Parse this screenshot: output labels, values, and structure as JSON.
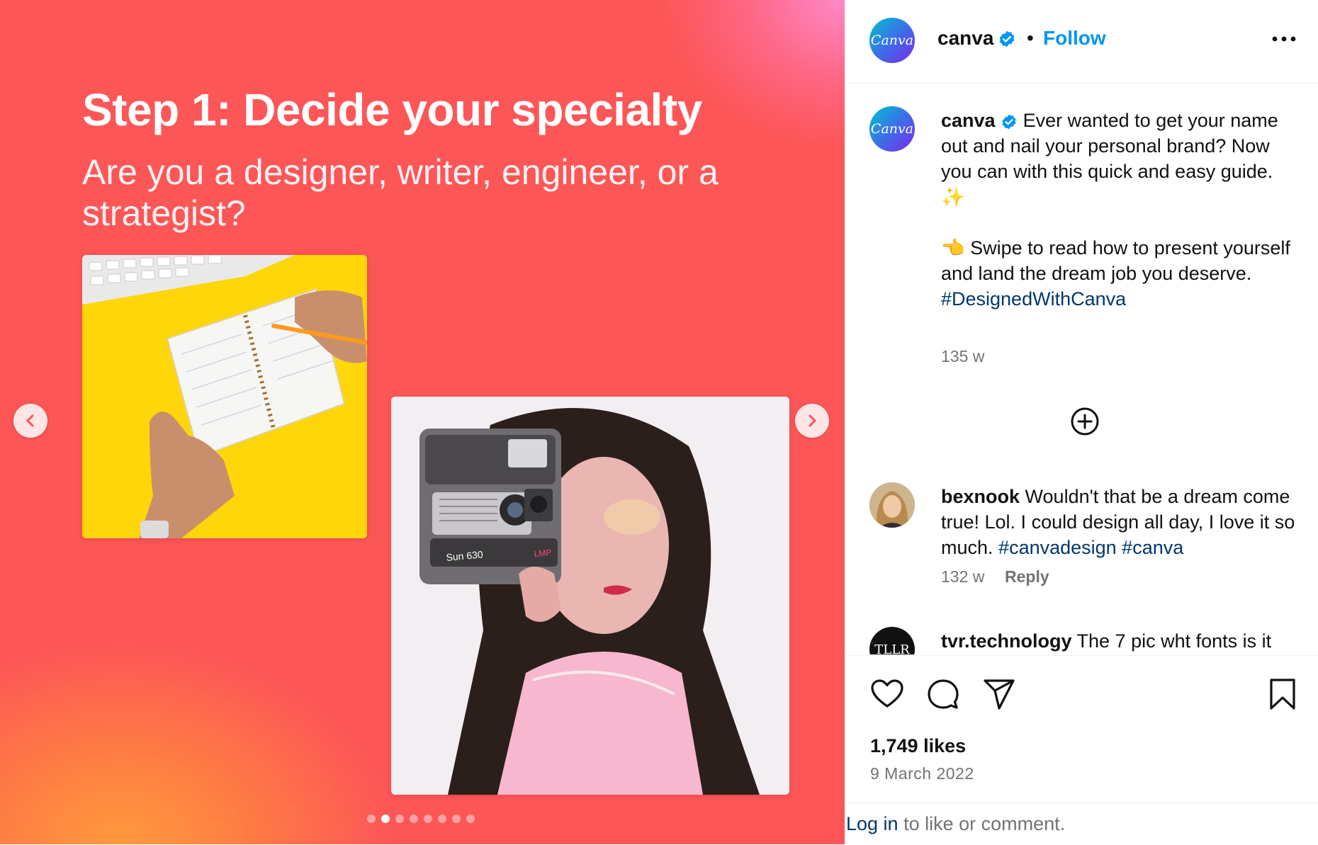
{
  "slide": {
    "title": "Step 1: Decide your specialty",
    "subtitle": "Are you a designer, writer, engineer, or a strategist?",
    "camera_model_text": "Sun 630",
    "camera_brand_text": "LMP",
    "current_index": 2,
    "total": 8,
    "background_color": "#fd5657"
  },
  "header": {
    "avatar_text": "Canva",
    "username": "canva",
    "separator": "•",
    "follow_label": "Follow"
  },
  "caption": {
    "avatar_text": "Canva",
    "username": "canva",
    "line1": "Ever wanted to get your name out and nail your personal brand? Now you can with this quick and easy guide.",
    "emoji1": "✨",
    "emoji2": "👈",
    "line2": "Swipe to read how to present yourself and land the dream job you deserve.",
    "hashtag": "#DesignedWithCanva",
    "time": "135 w"
  },
  "comments": [
    {
      "username": "bexnook",
      "text": "Wouldn't that be a dream come true! Lol. I could design all day, I love it so much.",
      "hashtags": "#canvadesign #canva",
      "time": "132 w",
      "reply_label": "Reply"
    },
    {
      "username": "tvr.technology",
      "avatar_text": "TLLR",
      "text": "The 7 pic wht fonts is it"
    }
  ],
  "actions": {
    "likes": "1,749 likes",
    "date": "9 March 2022"
  },
  "login": {
    "link_text": "Log in",
    "rest_text": "to like or comment."
  },
  "icons": [
    "chevron-left-icon",
    "chevron-right-icon",
    "verified-badge-icon",
    "more-options-icon",
    "plus-circle-icon",
    "heart-icon",
    "comment-icon",
    "share-icon",
    "bookmark-icon"
  ],
  "colors": {
    "follow": "#0095f6",
    "hashtag": "#00376b",
    "muted": "#737373",
    "verified": "#0095f6"
  }
}
